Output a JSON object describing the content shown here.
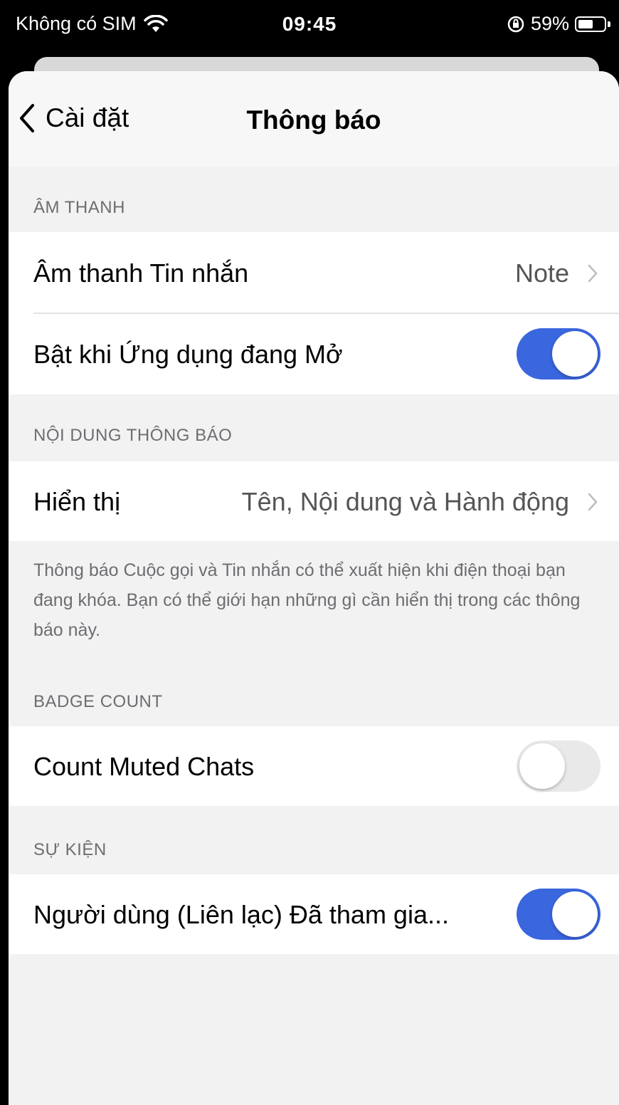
{
  "status_bar": {
    "carrier": "Không có SIM",
    "time": "09:45",
    "battery": "59%",
    "battery_level": 0.59,
    "icons": [
      "wifi-icon",
      "lock-rotation-icon",
      "battery-icon"
    ]
  },
  "nav": {
    "back_label": "Cài đặt",
    "title": "Thông báo",
    "back_icon": "chevron-left-icon"
  },
  "sections": {
    "sound": {
      "header": "ÂM THANH",
      "message_sound": {
        "label": "Âm thanh Tin nhắn",
        "value": "Note"
      },
      "in_app": {
        "label": "Bật khi Ứng dụng đang Mở",
        "enabled": true
      }
    },
    "content": {
      "header": "NỘI DUNG THÔNG BÁO",
      "display": {
        "label": "Hiển thị",
        "value": "Tên, Nội dung và Hành động"
      },
      "footer": "Thông báo Cuộc gọi và Tin nhắn có thể xuất hiện khi điện thoại bạn đang khóa. Bạn có thể giới hạn những gì cần hiển thị trong các thông báo này."
    },
    "badge": {
      "header": "BADGE COUNT",
      "count_muted": {
        "label": "Count Muted Chats",
        "enabled": false
      }
    },
    "events": {
      "header": "SỰ KIỆN",
      "contact_joined": {
        "label": "Người dùng (Liên lạc) Đã tham gia...",
        "enabled": true
      }
    }
  },
  "colors": {
    "toggle_on": "#3a66de",
    "toggle_off": "#e9e9ea",
    "background": "#f2f2f2"
  }
}
